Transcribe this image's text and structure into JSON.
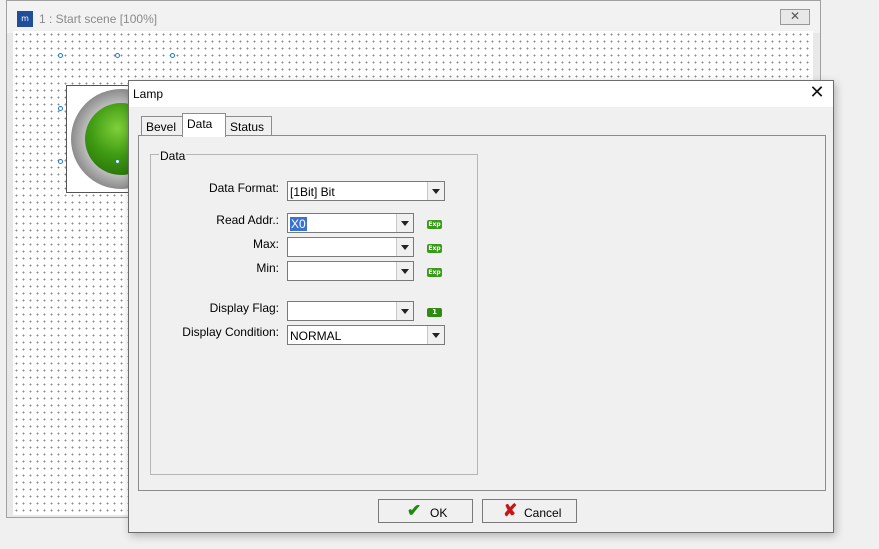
{
  "scene_window": {
    "title": "1 : Start scene [100%]",
    "app_icon": "app-logo-icon",
    "close_label": "✕"
  },
  "dialog": {
    "title": "Lamp",
    "close_label": "✕",
    "tabs": [
      {
        "label": "Bevel",
        "active": false
      },
      {
        "label": "Data",
        "active": true
      },
      {
        "label": "Status",
        "active": false
      }
    ],
    "group_label": "Data",
    "fields": {
      "data_format": {
        "label": "Data Format:",
        "value": "[1Bit] Bit"
      },
      "read_addr": {
        "label": "Read Addr.:",
        "value": "X0",
        "tag": "Exp"
      },
      "max": {
        "label": "Max:",
        "value": "",
        "tag": "Exp"
      },
      "min": {
        "label": "Min:",
        "value": "",
        "tag": "Exp"
      },
      "display_flag": {
        "label": "Display Flag:",
        "value": "",
        "tag": "1"
      },
      "display_condition": {
        "label": "Display Condition:",
        "value": "NORMAL"
      }
    },
    "buttons": {
      "ok": {
        "label": "OK",
        "icon": "check-icon"
      },
      "cancel": {
        "label": "Cancel",
        "icon": "cross-icon"
      }
    }
  },
  "colors": {
    "selection": "#3a72d0",
    "tag_green": "#3a9a1a",
    "ok_icon": "#1d8a10",
    "cancel_icon": "#c8151a"
  }
}
